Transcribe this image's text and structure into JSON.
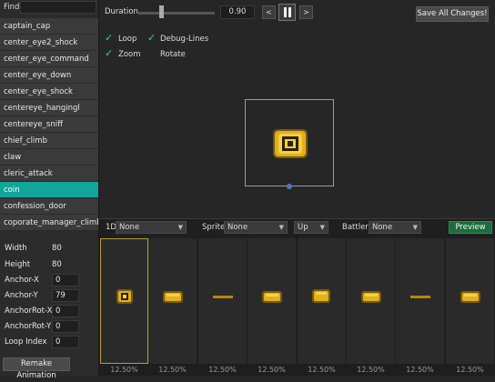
{
  "find": {
    "label": "Find:",
    "value": ""
  },
  "animations": [
    "captain_cap",
    "center_eye2_shock",
    "center_eye_command",
    "center_eye_down",
    "center_eye_shock",
    "centereye_hangingl",
    "centereye_sniff",
    "chief_climb",
    "claw",
    "cleric_attack",
    "coin",
    "confession_door",
    "coporate_manager_climb"
  ],
  "selected_animation": "coin",
  "props": {
    "width_label": "Width",
    "width_value": "80",
    "height_label": "Height",
    "height_value": "80",
    "anchor_x_label": "Anchor-X",
    "anchor_x_value": "0",
    "anchor_y_label": "Anchor-Y",
    "anchor_y_value": "79",
    "anchor_rot_x_label": "AnchorRot-X",
    "anchor_rot_x_value": "0",
    "anchor_rot_y_label": "AnchorRot-Y",
    "anchor_rot_y_value": "0",
    "loop_index_label": "Loop Index",
    "loop_index_value": "0"
  },
  "remake_label": "Remake Animation",
  "toolbar": {
    "duration_label": "Duration",
    "duration_value": "0.90",
    "duration_slider_fraction": 0.3,
    "prev_label": "<",
    "next_label": ">",
    "save_label": "Save All Changes!"
  },
  "options": {
    "loop_label": "Loop",
    "loop_checked": true,
    "debug_label": "Debug-Lines",
    "debug_checked": true,
    "zoom_label": "Zoom",
    "zoom_checked": true,
    "rotate_label": "Rotate",
    "rotate_checked": false
  },
  "bottom": {
    "id_label": "1D",
    "id_value": "None",
    "sprite_label": "Sprite",
    "sprite_value": "None",
    "direction_value": "Up",
    "battler_label": "Battler",
    "battler_value": "None",
    "preview_label": "Preview"
  },
  "frames": [
    {
      "kind": "coin",
      "pct": "12.50%"
    },
    {
      "kind": "coin-side",
      "pct": "12.50%"
    },
    {
      "kind": "line",
      "pct": "12.50%"
    },
    {
      "kind": "coin-side",
      "pct": "12.50%"
    },
    {
      "kind": "coin-wide",
      "pct": "12.50%"
    },
    {
      "kind": "coin-side",
      "pct": "12.50%"
    },
    {
      "kind": "line",
      "pct": "12.50%"
    },
    {
      "kind": "coin-side",
      "pct": "12.50%"
    }
  ],
  "colors": {
    "accent": "#12a59a",
    "gold": "#e0b020",
    "selected_frame_border": "#b89a3a",
    "preview_button": "#1d6b3f"
  }
}
